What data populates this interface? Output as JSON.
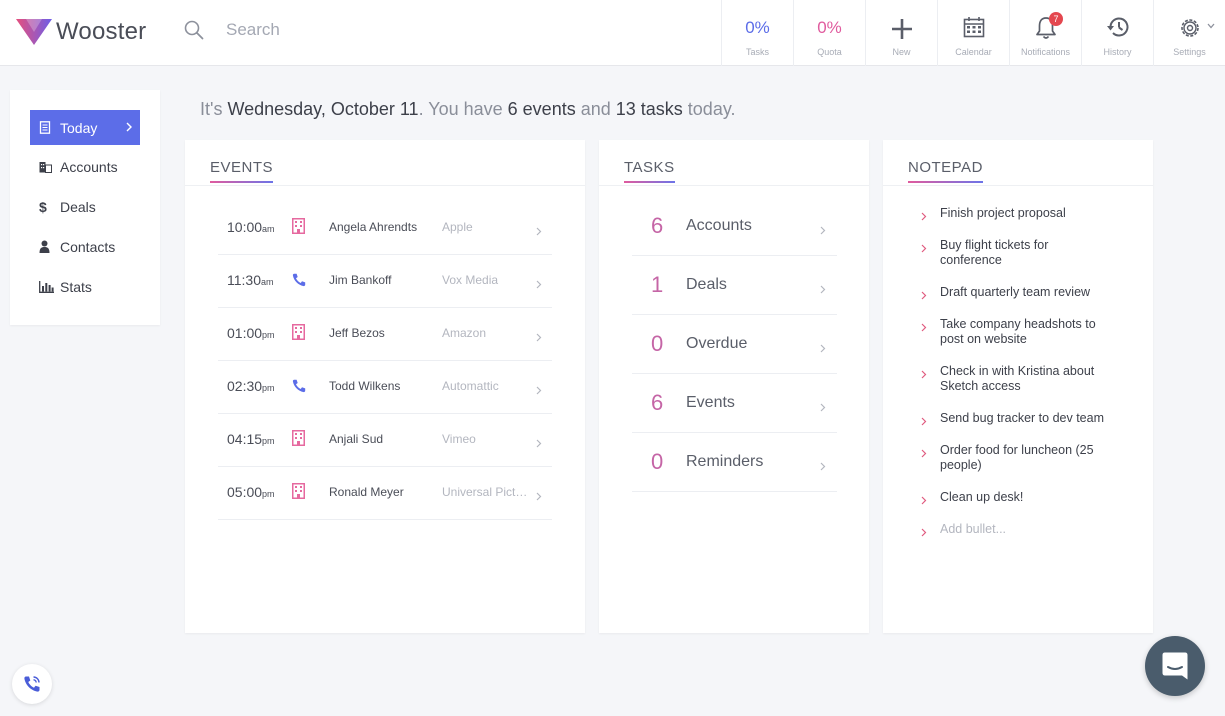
{
  "app": {
    "name": "Wooster"
  },
  "colors": {
    "accent": "#5c6de8",
    "pink": "#e05b9e",
    "event_building": "#e6699f",
    "event_phone": "#5c6de8",
    "badge": "#e4474f"
  },
  "search": {
    "placeholder": "Search",
    "icon": "search-icon"
  },
  "nav": {
    "tasks": {
      "value": "0%",
      "label": "Tasks"
    },
    "quota": {
      "value": "0%",
      "label": "Quota"
    },
    "new": {
      "label": "New",
      "icon": "plus-icon"
    },
    "calendar": {
      "label": "Calendar",
      "icon": "calendar-icon"
    },
    "notifications": {
      "label": "Notifications",
      "icon": "bell-icon",
      "badge": "7"
    },
    "history": {
      "label": "History",
      "icon": "history-icon"
    },
    "settings": {
      "label": "Settings",
      "icon": "gear-icon"
    }
  },
  "sidebar": {
    "items": [
      {
        "label": "Today",
        "icon": "document-icon",
        "active": true
      },
      {
        "label": "Accounts",
        "icon": "building-icon"
      },
      {
        "label": "Deals",
        "icon": "dollar-icon"
      },
      {
        "label": "Contacts",
        "icon": "person-icon"
      },
      {
        "label": "Stats",
        "icon": "bar-chart-icon"
      }
    ]
  },
  "greeting": {
    "prefix": "It's ",
    "date": "Wednesday, October 11",
    "mid1": ". You have ",
    "events": "6 events",
    "mid2": " and ",
    "tasks": "13 tasks",
    "suffix": " today."
  },
  "events": {
    "title": "EVENTS",
    "rows": [
      {
        "time": "10:00",
        "ampm": "am",
        "type": "building-icon",
        "name": "Angela Ahrendts",
        "company": "Apple"
      },
      {
        "time": "11:30",
        "ampm": "am",
        "type": "phone-icon",
        "name": "Jim Bankoff",
        "company": "Vox Media"
      },
      {
        "time": "01:00",
        "ampm": "pm",
        "type": "building-icon",
        "name": "Jeff Bezos",
        "company": "Amazon"
      },
      {
        "time": "02:30",
        "ampm": "pm",
        "type": "phone-icon",
        "name": "Todd Wilkens",
        "company": "Automattic"
      },
      {
        "time": "04:15",
        "ampm": "pm",
        "type": "building-icon",
        "name": "Anjali Sud",
        "company": "Vimeo"
      },
      {
        "time": "05:00",
        "ampm": "pm",
        "type": "building-icon",
        "name": "Ronald Meyer",
        "company": "Universal Pictures"
      }
    ]
  },
  "tasks": {
    "title": "TASKS",
    "rows": [
      {
        "count": "6",
        "label": "Accounts"
      },
      {
        "count": "1",
        "label": "Deals"
      },
      {
        "count": "0",
        "label": "Overdue"
      },
      {
        "count": "6",
        "label": "Events"
      },
      {
        "count": "0",
        "label": "Reminders"
      }
    ]
  },
  "notepad": {
    "title": "NOTEPAD",
    "items": [
      "Finish project proposal",
      "Buy flight tickets for conference",
      "Draft quarterly team review",
      "Take company headshots to post on website",
      "Check in with Kristina about Sketch access",
      "Send bug tracker to dev team",
      "Order food for luncheon (25 people)",
      "Clean up desk!"
    ],
    "add_placeholder": "Add bullet..."
  }
}
